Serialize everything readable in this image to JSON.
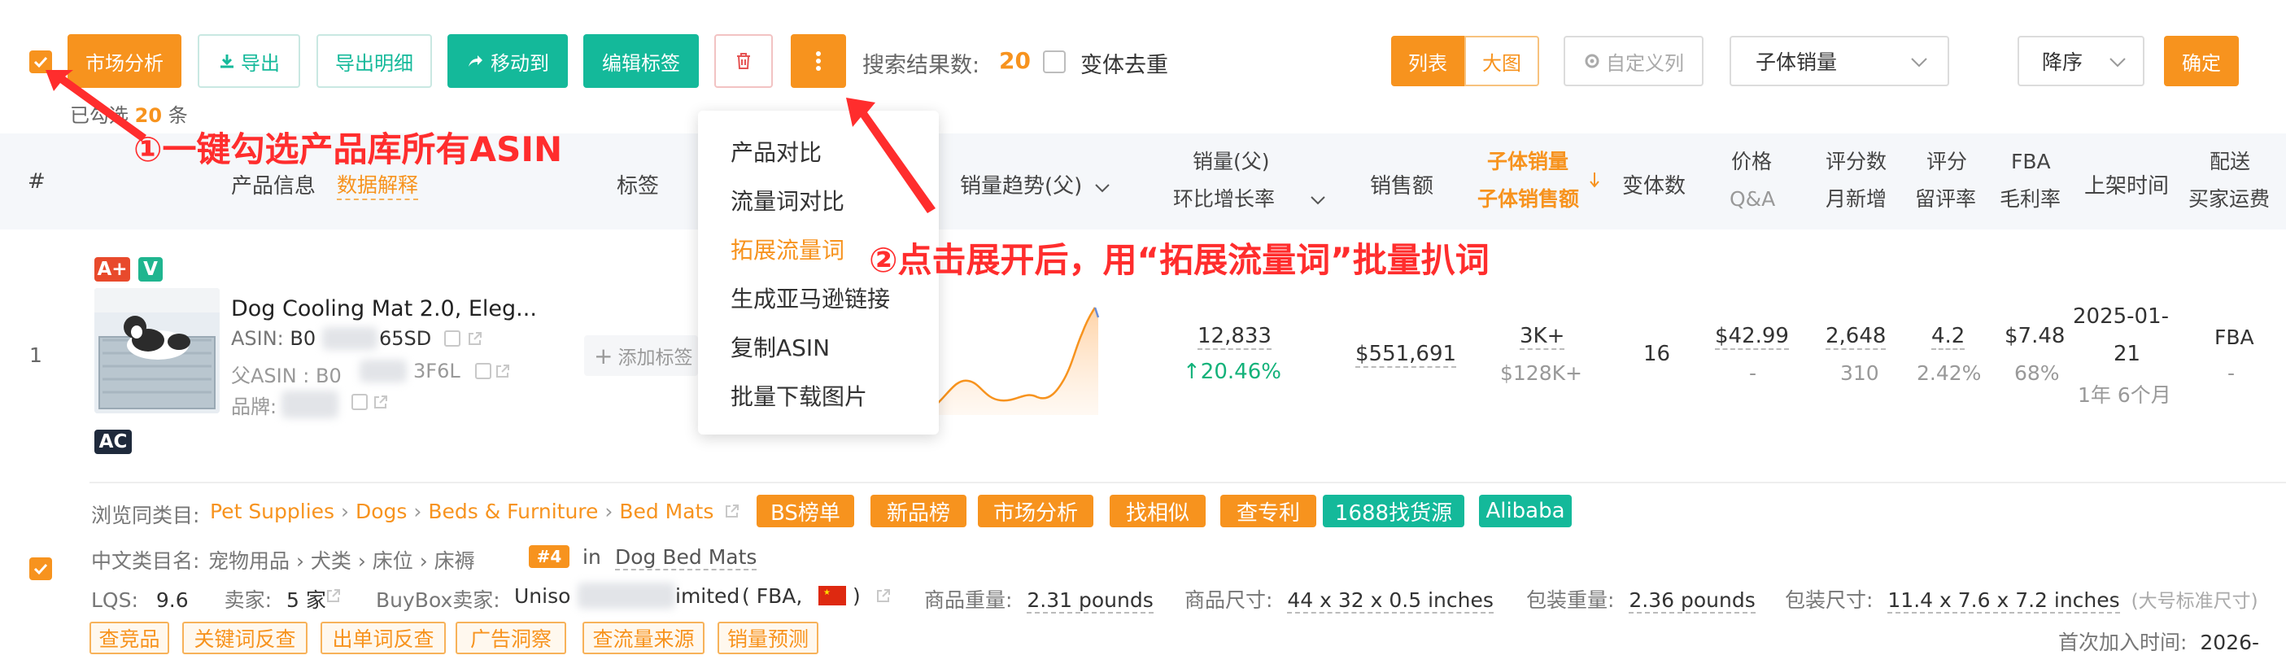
{
  "toolbar": {
    "market_analysis": "市场分析",
    "export": "导出",
    "export_detail": "导出明细",
    "move_to": "移动到",
    "edit_tags": "编辑标签",
    "result_label": "搜索结果数:",
    "result_count": "20",
    "dedupe_label": "变体去重",
    "view_list": "列表",
    "view_grid": "大图",
    "custom_columns": "自定义列",
    "sort_field": "子体销量",
    "sort_order": "降序",
    "confirm": "确定"
  },
  "selection": {
    "prefix": "已勾选",
    "count": "20",
    "suffix": "条"
  },
  "dropdown": {
    "items": [
      "产品对比",
      "流量词对比",
      "拓展流量词",
      "生成亚马逊链接",
      "复制ASIN",
      "批量下载图片"
    ],
    "highlighted": "拓展流量词"
  },
  "table_header": {
    "index": "#",
    "product_info": "产品信息",
    "data_explain": "数据解释",
    "tags": "标签",
    "sales_trend": "销量趋势(父)",
    "sales_parent": "销量(父)",
    "mom_growth": "环比增长率",
    "revenue": "销售额",
    "child_sales": "子体销量",
    "child_revenue": "子体销售额",
    "variants": "变体数",
    "price": "价格",
    "qa": "Q&A",
    "ratings": "评分数",
    "monthly_new": "月新增",
    "rating": "评分",
    "retention": "留评率",
    "fba": "FBA",
    "margin": "毛利率",
    "listing_date": "上架时间",
    "delivery": "配送",
    "buyer_shipping": "买家运费"
  },
  "row": {
    "index": "1",
    "badge_aplus": "A+",
    "badge_v": "V",
    "badge_ac": "AC",
    "title": "Dog Cooling Mat 2.0, Eleg...",
    "asin_label": "ASIN:",
    "asin_start": "B0",
    "asin_end": "65SD",
    "parent_asin_label": "父ASIN :",
    "parent_asin_start": "B0",
    "parent_asin_end": "3F6L",
    "brand_label": "品牌:",
    "add_tag": "添加标签",
    "sales": "12,833",
    "growth": "20.46%",
    "revenue": "$551,691",
    "child_sales": "3K+",
    "child_revenue": "$128K+",
    "variants": "16",
    "price": "$42.99",
    "qa": "-",
    "ratings": "2,648",
    "monthly_new": "310",
    "rating": "4.2",
    "retention": "2.42%",
    "fba_fee": "$7.48",
    "margin": "68%",
    "listing_date_line1": "2025-01-",
    "listing_date_line2": "21",
    "age": "1年 6个月",
    "delivery": "FBA",
    "shipping": "-"
  },
  "category": {
    "label": "浏览同类目:",
    "path": [
      "Pet Supplies",
      "Dogs",
      "Beds & Furniture",
      "Bed Mats"
    ],
    "buttons": [
      "BS榜单",
      "新品榜",
      "市场分析",
      "找相似",
      "查专利"
    ],
    "source_1688": "1688找货源",
    "alibaba": "Alibaba",
    "cn_label": "中文类目名:",
    "cn_path": "宠物用品 › 犬类 › 床位 › 床褥",
    "rank": "#4",
    "rank_in": "in",
    "rank_cat": "Dog Bed Mats"
  },
  "details": {
    "lqs_label": "LQS:",
    "lqs": "9.6",
    "sellers_label": "卖家:",
    "sellers": "5 家",
    "buybox_label": "BuyBox卖家:",
    "buybox_start": "Uniso",
    "buybox_end": "imited",
    "buybox_type": "( FBA,",
    "buybox_close": ")",
    "weight_label": "商品重量:",
    "weight": "2.31 pounds",
    "size_label": "商品尺寸:",
    "size": "44 x 32 x 0.5 inches",
    "pkg_weight_label": "包装重量:",
    "pkg_weight": "2.36 pounds",
    "pkg_size_label": "包装尺寸:",
    "pkg_size": "11.4 x 7.6 x 7.2 inches",
    "pkg_class": "(大号标准尺寸)"
  },
  "actions": [
    "查竞品",
    "关键词反查",
    "出单词反查",
    "广告洞察",
    "查流量来源",
    "销量预测"
  ],
  "first_added": {
    "label": "首次加入时间:",
    "value": "2026-"
  },
  "annotations": {
    "one": "①一键勾选产品库所有ASIN",
    "two": "②点击展开后，用“拓展流量词”批量扒词"
  },
  "colors": {
    "accent": "#f7931e",
    "teal": "#14b99a",
    "annotation": "#ff2d2d",
    "growth": "#13b27a"
  },
  "icons": [
    "check-icon",
    "download-icon",
    "share-icon",
    "trash-icon",
    "more-vertical-icon",
    "gear-icon",
    "chevron-down-icon",
    "plus-icon",
    "copy-icon",
    "external-link-icon",
    "arrow-up-icon",
    "sort-down-icon",
    "china-flag-icon"
  ]
}
